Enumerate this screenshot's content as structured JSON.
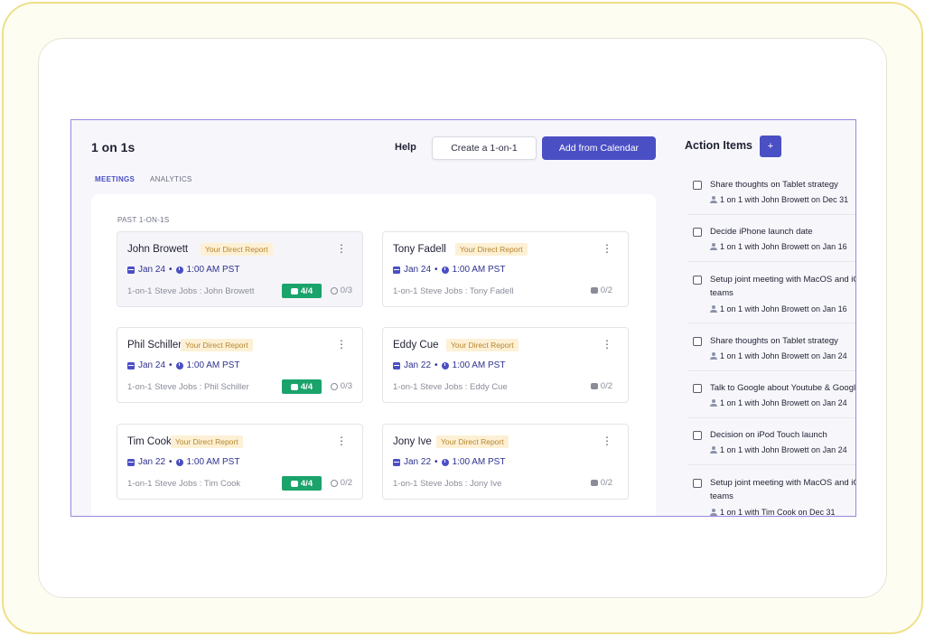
{
  "header": {
    "title": "1 on 1s",
    "help_label": "Help",
    "create_label": "Create a 1-on-1",
    "add_calendar_label": "Add from Calendar"
  },
  "tabs": [
    {
      "label": "MEETINGS",
      "active": true
    },
    {
      "label": "ANALYTICS",
      "active": false
    }
  ],
  "section_label": "PAST 1-ON-1S",
  "meetings": [
    {
      "name": "John Browett",
      "badge": "Your Direct Report",
      "date": "Jan 24",
      "time": "1:00 AM PST",
      "meta": "1-on-1 Steve Jobs : John Browett",
      "talking_points": "4/4",
      "action_items": "0/3"
    },
    {
      "name": "Tony Fadell",
      "badge": "Your Direct Report",
      "date": "Jan 24",
      "time": "1:00 AM PST",
      "meta": "1-on-1 Steve Jobs : Tony Fadell",
      "talking_points": "0/2"
    },
    {
      "name": "Phil Schiller",
      "badge": "Your Direct Report",
      "date": "Jan 24",
      "time": "1:00 AM PST",
      "meta": "1-on-1 Steve Jobs : Phil Schiller",
      "talking_points": "4/4",
      "action_items": "0/3"
    },
    {
      "name": "Eddy Cue",
      "badge": "Your Direct Report",
      "date": "Jan 22",
      "time": "1:00 AM PST",
      "meta": "1-on-1 Steve Jobs : Eddy Cue",
      "talking_points": "0/2"
    },
    {
      "name": "Tim Cook",
      "badge": "Your Direct Report",
      "date": "Jan 22",
      "time": "1:00 AM PST",
      "meta": "1-on-1 Steve Jobs : Tim Cook",
      "talking_points": "4/4",
      "action_items": "0/2"
    },
    {
      "name": "Jony Ive",
      "badge": "Your Direct Report",
      "date": "Jan 22",
      "time": "1:00 AM PST",
      "meta": "1-on-1 Steve Jobs : Jony Ive",
      "talking_points": "0/2"
    }
  ],
  "action_items": {
    "title": "Action Items",
    "add_label": "+",
    "items": [
      {
        "text": "Share thoughts on Tablet strategy",
        "sub": "1 on 1 with John Browett on Dec 31"
      },
      {
        "text": "Decide iPhone launch date",
        "sub": "1 on 1 with John Browett on Jan 16"
      },
      {
        "text": "Setup joint meeting with MacOS and iOS",
        "text2": "teams",
        "sub": "1 on 1 with John Browett on Jan 16"
      },
      {
        "text": "Share thoughts on Tablet strategy",
        "sub": "1 on 1 with John Browett on Jan 24"
      },
      {
        "text": "Talk to Google about Youtube & Google Maps",
        "sub": "1 on 1 with John Browett on Jan 24"
      },
      {
        "text": "Decision on iPod Touch launch",
        "sub": "1 on 1 with John Browett on Jan 24"
      },
      {
        "text": "Setup joint meeting with MacOS and iOS",
        "text2": "teams",
        "sub": "1 on 1 with Tim Cook on Dec 31"
      }
    ]
  },
  "colors": {
    "accent": "#4b4fc4",
    "success": "#1aa36b",
    "badge_bg": "#fdf0d4",
    "badge_text": "#b6862f",
    "frame_border": "#9b86e0"
  }
}
